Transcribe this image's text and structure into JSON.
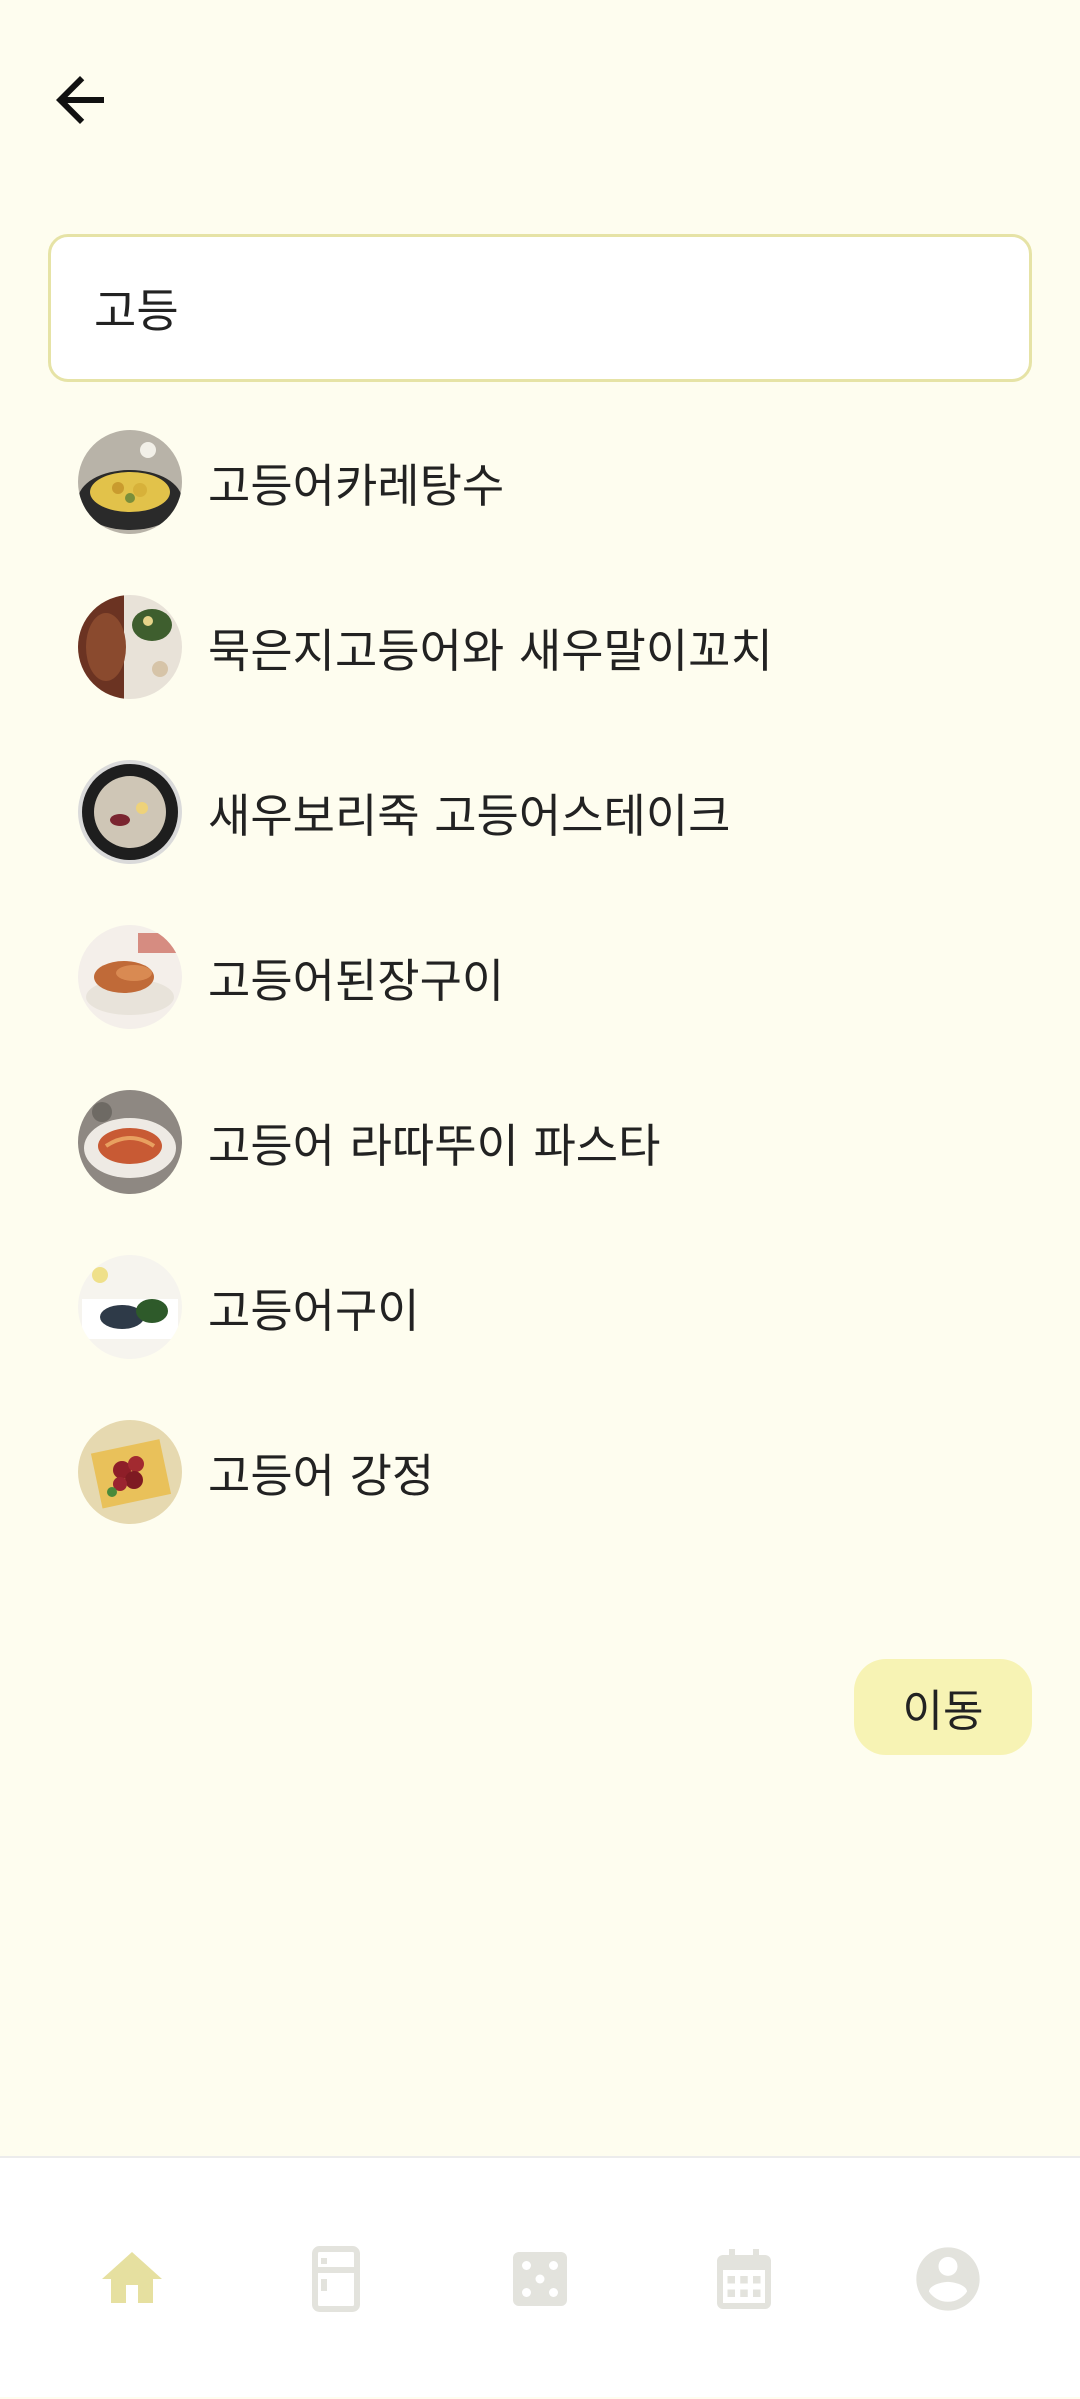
{
  "header": {
    "back_icon": "arrow-left-icon"
  },
  "search": {
    "value": "고등",
    "placeholder": ""
  },
  "results": [
    {
      "label": "고등어카레탕수",
      "thumb": "curry-dish-photo"
    },
    {
      "label": "묵은지고등어와 새우말이꼬치",
      "thumb": "skewer-dish-photo"
    },
    {
      "label": "새우보리죽 고등어스테이크",
      "thumb": "porridge-dish-photo"
    },
    {
      "label": "고등어된장구이",
      "thumb": "grilled-fish-photo"
    },
    {
      "label": "고등어 라따뚜이 파스타",
      "thumb": "pasta-dish-photo"
    },
    {
      "label": "고등어구이",
      "thumb": "grilled-mackerel-photo"
    },
    {
      "label": "고등어 강정",
      "thumb": "fried-mackerel-photo"
    }
  ],
  "go_button": {
    "label": "이동"
  },
  "bottom_nav": [
    {
      "icon": "home-icon",
      "active": true
    },
    {
      "icon": "fridge-icon",
      "active": false
    },
    {
      "icon": "dice-icon",
      "active": false
    },
    {
      "icon": "calendar-icon",
      "active": false
    },
    {
      "icon": "account-icon",
      "active": false
    }
  ],
  "colors": {
    "background": "#FEFDEF",
    "accent": "#F7F3B4",
    "search_border": "#E6E3A6",
    "nav_active": "#E6E0A0",
    "nav_inactive": "#E3E3DD"
  }
}
